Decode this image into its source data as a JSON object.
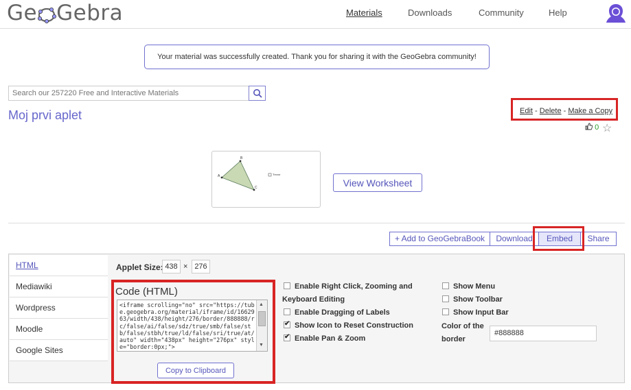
{
  "header": {
    "logo_text_left": "Ge",
    "logo_text_right": "Gebra",
    "nav": [
      "Materials",
      "Downloads",
      "Community",
      "Help"
    ]
  },
  "notice": "Your material was successfully created. Thank you for sharing it with the GeoGebra community!",
  "search": {
    "placeholder": "Search our 257220 Free and Interactive Materials"
  },
  "material": {
    "title": "Moj prvi aplet",
    "edit": "Edit",
    "sep": "-",
    "delete": "Delete",
    "make_copy": "Make a Copy",
    "likes": "0",
    "view_worksheet": "View Worksheet",
    "thumb_labels": {
      "a": "A",
      "b": "B",
      "c": "C",
      "checkbox": "Trezor"
    }
  },
  "actions": {
    "add_book": "+ Add to GeoGebraBook",
    "download": "Download",
    "embed": "Embed",
    "share": "Share"
  },
  "embed": {
    "tabs": [
      "HTML",
      "Mediawiki",
      "Wordpress",
      "Moodle",
      "Google Sites"
    ],
    "size_label": "Applet Size:",
    "width": "438",
    "times": "×",
    "height": "276",
    "code_title": "Code (HTML)",
    "code": "<iframe scrolling=\"no\" src=\"https://tube.geogebra.org/material/iframe/id/1662963/width/438/height/276/border/888888/rc/false/ai/false/sdz/true/smb/false/stb/false/stbh/true/ld/false/sri/true/at/auto\" width=\"438px\" height=\"276px\" style=\"border:0px;\">",
    "copy": "Copy to Clipboard",
    "options_left": [
      {
        "label": "Enable Right Click, Zooming and",
        "label2": "Keyboard Editing",
        "checked": false
      },
      {
        "label": "Enable Dragging of Labels",
        "checked": false
      },
      {
        "label": "Show Icon to Reset Construction",
        "checked": true
      },
      {
        "label": "Enable Pan & Zoom",
        "checked": true
      }
    ],
    "options_right": [
      {
        "label": "Show Menu",
        "checked": false
      },
      {
        "label": "Show Toolbar",
        "checked": false
      },
      {
        "label": "Show Input Bar",
        "checked": false
      }
    ],
    "color_label": "Color of the",
    "color_label2": "border",
    "color_value": "#888888"
  },
  "colors": {
    "accent": "#5555bb",
    "highlight": "#d82424"
  }
}
